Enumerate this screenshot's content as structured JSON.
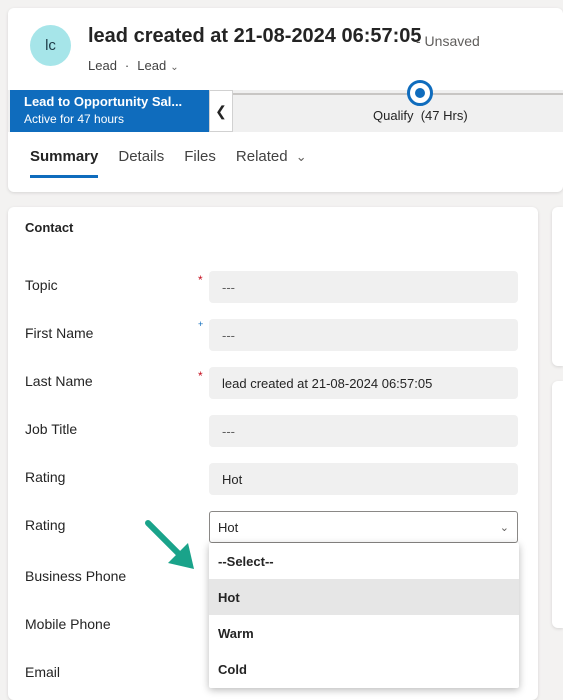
{
  "record": {
    "avatar_initials": "lc",
    "title": "lead created at 21-08-2024 06:57:05",
    "status": "- Unsaved",
    "entity": "Lead",
    "form": "Lead"
  },
  "process": {
    "name": "Lead to Opportunity Sal...",
    "active_for": "Active for 47 hours",
    "stage": "Qualify",
    "stage_duration": "(47 Hrs)"
  },
  "tabs": [
    "Summary",
    "Details",
    "Files",
    "Related"
  ],
  "section": {
    "title": "Contact"
  },
  "fields": [
    {
      "label": "Topic",
      "marker": "required",
      "value": "---"
    },
    {
      "label": "First Name",
      "marker": "recommended",
      "value": "---"
    },
    {
      "label": "Last Name",
      "marker": "required",
      "value": "lead created at 21-08-2024 06:57:05"
    },
    {
      "label": "Job Title",
      "marker": "",
      "value": "---"
    },
    {
      "label": "Rating",
      "marker": "",
      "value": "Hot"
    },
    {
      "label": "Rating",
      "marker": "",
      "value": "Hot"
    },
    {
      "label": "Business Phone",
      "marker": "",
      "value": ""
    },
    {
      "label": "Mobile Phone",
      "marker": "",
      "value": ""
    },
    {
      "label": "Email",
      "marker": "",
      "value": ""
    }
  ],
  "markers": {
    "required": "*",
    "recommended": "+"
  },
  "rating_dropdown": {
    "options": [
      "--Select--",
      "Hot",
      "Warm",
      "Cold"
    ],
    "highlighted": "Hot"
  },
  "colors": {
    "accent": "#0f6cbd",
    "annotation_arrow": "#1aa38a",
    "required": "#c50f1f"
  }
}
